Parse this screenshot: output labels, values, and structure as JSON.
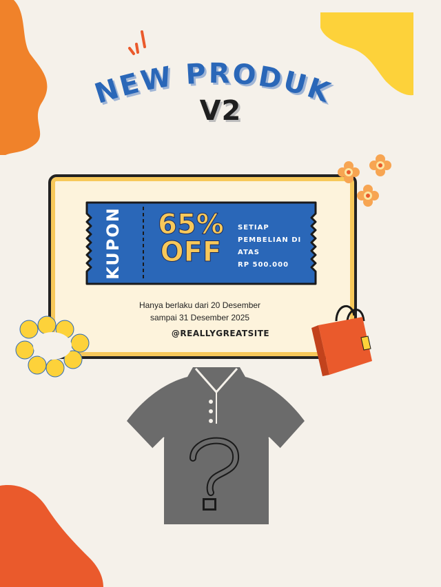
{
  "poster": {
    "title": "NEW PRODUK",
    "subtitle": "V2"
  },
  "coupon": {
    "label": "KUPON",
    "discount_line1": "65%",
    "discount_line2": "OFF",
    "condition_lines": [
      "SETIAP",
      "PEMBELIAN DI",
      "ATAS",
      "RP 500.000"
    ],
    "validity_line1": "Hanya berlaku dari 20 Desember",
    "validity_line2": "sampai 31 Desember 2025",
    "site": "@REALLYGREATSITE"
  },
  "colors": {
    "background": "#f5f1ea",
    "blue": "#2a67b8",
    "yellow": "#f7c85a",
    "orange": "#f0822a",
    "red_orange": "#ea5a2c",
    "shirt": "#6b6b6b"
  },
  "icons": [
    "sparkle-icon",
    "flower-icon",
    "shopping-bag-icon",
    "mystery-shirt-icon",
    "question-mark-icon"
  ]
}
